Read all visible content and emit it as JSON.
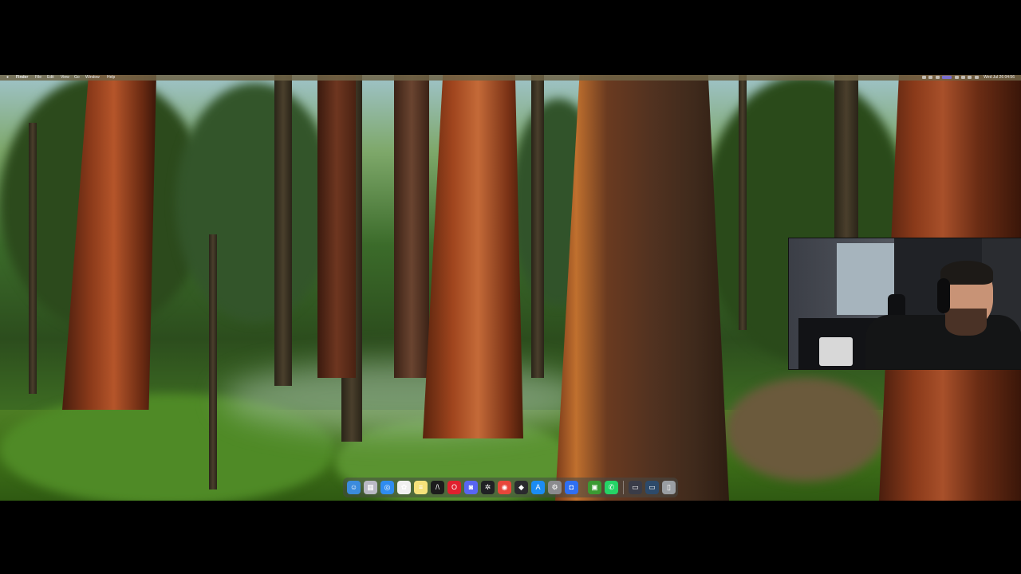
{
  "menubar": {
    "apple": "",
    "app_name": "Finder",
    "items": [
      "File",
      "Edit",
      "View",
      "Go",
      "Window",
      "Help"
    ],
    "clock": "Wed Jul 26 04:56"
  },
  "dock": {
    "apps": [
      {
        "name": "finder-icon",
        "color": "#3b8bdc",
        "glyph": "☺"
      },
      {
        "name": "launchpad-icon",
        "color": "#b9b9c4",
        "glyph": "▦"
      },
      {
        "name": "safari-icon",
        "color": "#2f8cf0",
        "glyph": "◎"
      },
      {
        "name": "photos-icon",
        "color": "#f0f0f0",
        "glyph": "✿"
      },
      {
        "name": "notes-icon",
        "color": "#f5e27a",
        "glyph": "≡"
      },
      {
        "name": "cursor-editor-icon",
        "color": "#1c1c1c",
        "glyph": "/\\"
      },
      {
        "name": "opera-icon",
        "color": "#e0202e",
        "glyph": "O"
      },
      {
        "name": "discord-icon",
        "color": "#5865f2",
        "glyph": "◙"
      },
      {
        "name": "chatgpt-icon",
        "color": "#202124",
        "glyph": "✲"
      },
      {
        "name": "chrome-icon",
        "color": "#e8463a",
        "glyph": "◉"
      },
      {
        "name": "davinci-resolve-icon",
        "color": "#2a2a2e",
        "glyph": "◆"
      },
      {
        "name": "app-store-icon",
        "color": "#1b8cf3",
        "glyph": "A"
      },
      {
        "name": "system-settings-icon",
        "color": "#8b8b8e",
        "glyph": "⚙"
      },
      {
        "name": "roblox-icon",
        "color": "#2f6ff2",
        "glyph": "◘"
      },
      {
        "name": "minecraft-icon",
        "color": "#3b9a32",
        "glyph": "▣"
      },
      {
        "name": "whatsapp-icon",
        "color": "#25d366",
        "glyph": "✆"
      }
    ],
    "recents": [
      {
        "name": "screenshot-thumbnail-icon",
        "color": "#3a3c48",
        "glyph": "▭"
      },
      {
        "name": "screen-recording-thumbnail-icon",
        "color": "#2d4a6a",
        "glyph": "▭"
      },
      {
        "name": "trash-icon",
        "color": "#9a9ea3",
        "glyph": "▯"
      }
    ]
  }
}
